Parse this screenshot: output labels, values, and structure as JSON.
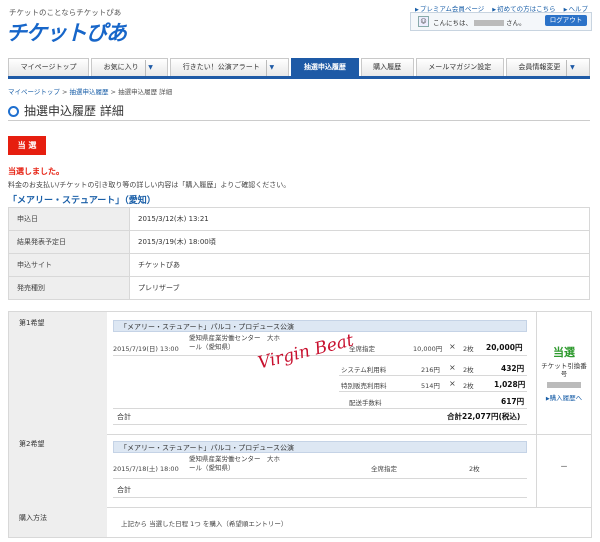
{
  "header": {
    "tagline": "チケットのことならチケットぴあ",
    "logo": "チケットぴあ",
    "links": [
      "プレミアム会員ページ",
      "初めての方はこちら",
      "ヘルプ"
    ],
    "greeting_pre": "こんにちは、",
    "greeting_post": "さん。",
    "login_label": "ログアウト"
  },
  "nav": {
    "tabs": [
      "マイページトップ",
      "お気に入り",
      "行きたい！公演アラート",
      "抽選申込履歴",
      "購入履歴",
      "メールマガジン設定",
      "会員情報変更"
    ],
    "active_index": 3
  },
  "breadcrumb": [
    "マイページトップ",
    "抽選申込履歴",
    "抽選申込履歴 詳細"
  ],
  "page_title": "抽選申込履歴 詳細",
  "status_badge": "当 選",
  "result_text": "当選しました。",
  "notice": "料金のお支払い/チケットの引き取り等の詳しい内容は「購入履歴」よりご確認ください。",
  "event_title": "「メアリー・ステュアート」（愛知）",
  "info": [
    {
      "label": "申込日",
      "value": "2015/3/12(木) 13:21"
    },
    {
      "label": "結果発表予定日",
      "value": "2015/3/19(木) 18:00頃"
    },
    {
      "label": "申込サイト",
      "value": "チケットぴあ"
    },
    {
      "label": "発売種別",
      "value": "プレリザーブ"
    }
  ],
  "choice1": {
    "label": "第1希望",
    "event": "「メアリー・ステュアート」パルコ・プロデュース公演",
    "date": "2015/7/19(日) 13:00",
    "venue": "愛知県産業労働センター　大ホール（愛知県）",
    "lines": [
      {
        "name": "全席指定",
        "price": "10,000円",
        "x": "×",
        "qty": "2枚",
        "amount": "20,000円"
      },
      {
        "name": "システム利用料",
        "price": "216円",
        "x": "×",
        "qty": "2枚",
        "amount": "432円"
      },
      {
        "name": "特別販売利用料",
        "price": "514円",
        "x": "×",
        "qty": "2枚",
        "amount": "1,028円"
      },
      {
        "name": "配送手数料",
        "price": "",
        "x": "",
        "qty": "",
        "amount": "617円"
      }
    ],
    "total_label": "合計",
    "total_value": "合計22,077円(税込)",
    "status": "当選",
    "ticket_label": "チケット引換番号",
    "history_link": "購入履歴へ",
    "signature": "Virgin Beat"
  },
  "choice2": {
    "label": "第2希望",
    "event": "「メアリー・ステュアート」パルコ・プロデュース公演",
    "date": "2015/7/18(土) 18:00",
    "venue": "愛知県産業労働センター　大ホール（愛知県）",
    "seat": "全席指定",
    "qty": "2枚",
    "total_label": "合計",
    "status": "－"
  },
  "purchase": {
    "label": "購入方法",
    "value": "上記から 当選した日程 1つ を購入（希望順エントリー）"
  }
}
